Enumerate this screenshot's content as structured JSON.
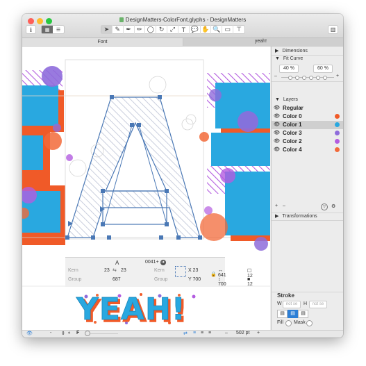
{
  "window": {
    "title": "DesignMatters-ColorFont.glyphs - DesignMatters"
  },
  "tabs": {
    "font": "Font",
    "active": "yeah!"
  },
  "panel": {
    "dimensions_label": "Dimensions",
    "fit_curve": {
      "label": "Fit Curve",
      "min": "40 %",
      "max": "60 %"
    },
    "layers_label": "Layers",
    "layers": [
      {
        "name": "Regular",
        "color": null
      },
      {
        "name": "Color 0",
        "color": "#f05a28"
      },
      {
        "name": "Color 1",
        "color": "#29a8e0"
      },
      {
        "name": "Color 3",
        "color": "#8e6cdb"
      },
      {
        "name": "Color 2",
        "color": "#b35ce0"
      },
      {
        "name": "Color 4",
        "color": "#f26a3a"
      }
    ],
    "transformations_label": "Transformations",
    "stroke": {
      "label": "Stroke",
      "w_label": "W",
      "w_placeholder": "not se",
      "h_label": "H",
      "h_placeholder": "not se",
      "fill_label": "Fill",
      "mask_label": "Mask"
    }
  },
  "info": {
    "glyph_name": "A",
    "unicode": "0041",
    "kern_label": "Kern",
    "kern_left": "23",
    "kern_right": "23",
    "group_label": "Group",
    "group_value": "687",
    "kern2_label": "Kern",
    "group2_label": "Group",
    "x_label": "X",
    "x_value": "23",
    "y_label": "Y",
    "y_value": "700",
    "w_value": "641",
    "h_value": "700",
    "count1": "12",
    "count2": "12"
  },
  "preview_text": "YEAH!",
  "bottom": {
    "dash": "-",
    "zoom": "502 pt",
    "minus": "–",
    "plus": "+"
  },
  "colors": {
    "orange": "#f05a28",
    "blue": "#29a8e0",
    "purple": "#8e6cdb",
    "violet": "#b35ce0",
    "coral": "#f26a3a",
    "node": "#4a78b5"
  }
}
